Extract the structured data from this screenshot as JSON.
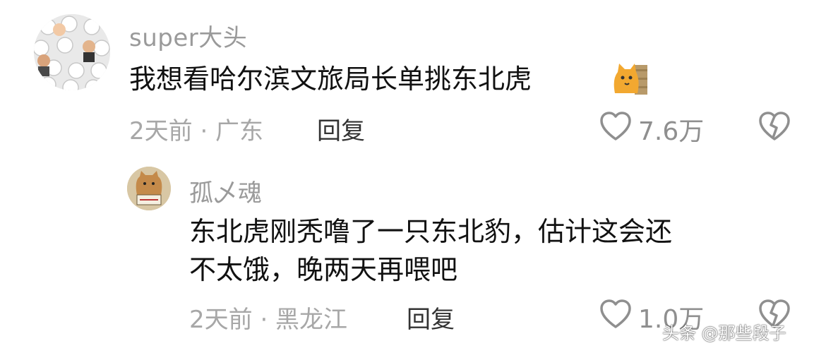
{
  "comments": [
    {
      "author": "super大头",
      "text": "我想看哈尔滨文旅局长单挑东北虎",
      "emoji": "cat-emoji",
      "meta": "2天前 · 广东",
      "reply_label": "回复",
      "likes": "7.6万"
    }
  ],
  "replies": [
    {
      "author": "孤乄魂",
      "text_line1": "东北虎刚秃噜了一只东北豹，估计这会还",
      "text_line2": "不太饿，晚两天再喂吧",
      "meta": "2天前 · 黑龙江",
      "reply_label": "回复",
      "likes": "1.0万"
    }
  ],
  "watermark": "头条 @那些段子",
  "colors": {
    "name": "#9a9a9a",
    "meta": "#a7a7a7",
    "text": "#111111",
    "icon": "#8f8f8f"
  }
}
